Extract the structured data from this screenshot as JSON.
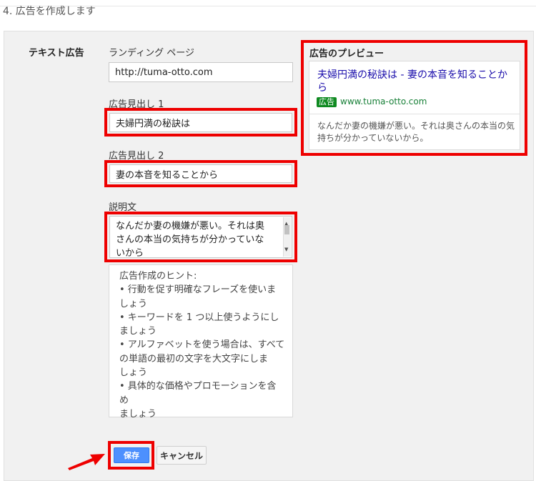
{
  "step": {
    "title": "4. 広告を作成します"
  },
  "form": {
    "section_label": "テキスト広告",
    "landing_page": {
      "label": "ランディング ページ",
      "value": "http://tuma-otto.com"
    },
    "headline1": {
      "label": "広告見出し 1",
      "value": "夫婦円満の秘訣は"
    },
    "headline2": {
      "label": "広告見出し 2",
      "value": "妻の本音を知ることから"
    },
    "description": {
      "label": "説明文",
      "lines": [
        "なんだか妻の機嫌が悪い。それは奥",
        "さんの本当の気持ちが分かっていな",
        "いから"
      ]
    }
  },
  "hints": {
    "title": "広告作成のヒント:",
    "lines": [
      "• 行動を促す明確なフレーズを使いま",
      "しょう",
      "• キーワードを 1 つ以上使うようにし",
      "ましょう",
      "• アルファベットを使う場合は、すべて",
      "の単語の最初の文字を大文字にしま",
      "しょう",
      "• 具体的な価格やプロモーションを含め",
      "ましょう"
    ]
  },
  "preview": {
    "title": "広告のプレビュー",
    "headline": "夫婦円満の秘訣は - 妻の本音を知ることから",
    "badge": "広告",
    "url": "www.tuma-otto.com",
    "description": "なんだか妻の機嫌が悪い。それは奥さんの本当の気持ちが分かっていないから。"
  },
  "buttons": {
    "save": "保存",
    "cancel": "キャンセル"
  },
  "colors": {
    "highlight": "#ee0000",
    "save_button": "#4d90fe",
    "ad_link": "#1a0dab",
    "ad_badge": "#0f8a21",
    "ad_url": "#188038"
  }
}
